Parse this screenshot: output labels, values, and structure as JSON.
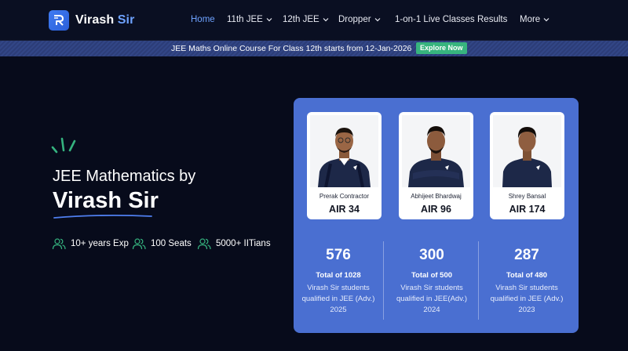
{
  "brand": {
    "name": "Virash",
    "accent": "Sir"
  },
  "nav": {
    "items": [
      {
        "label": "Home",
        "dropdown": false,
        "active": true
      },
      {
        "label": "11th JEE",
        "dropdown": true,
        "active": false
      },
      {
        "label": "12th JEE",
        "dropdown": true,
        "active": false
      },
      {
        "label": "Dropper",
        "dropdown": true,
        "active": false
      },
      {
        "label": "1-on-1 Live Classes",
        "dropdown": false,
        "active": false
      },
      {
        "label": "Results",
        "dropdown": false,
        "active": false
      },
      {
        "label": "More",
        "dropdown": true,
        "active": false
      }
    ]
  },
  "banner": {
    "text": "JEE Maths Online Course For Class 12th starts from 12-Jan-2026",
    "button": "Explore Now"
  },
  "hero": {
    "subtitle": "JEE Mathematics by",
    "title": "Virash Sir",
    "stats": [
      "10+ years Exp",
      "100 Seats",
      "5000+ IITians"
    ]
  },
  "results": {
    "students": [
      {
        "name": "Prerak Contractor",
        "air": "AIR 34"
      },
      {
        "name": "Abhijeet Bhardwaj",
        "air": "AIR 96"
      },
      {
        "name": "Shrey Bansal",
        "air": "AIR 174"
      }
    ],
    "columns": [
      {
        "count": "576",
        "total": "Total of 1028",
        "desc": "Virash Sir students qualified in JEE (Adv.) 2025"
      },
      {
        "count": "300",
        "total": "Total of 500",
        "desc": "Virash Sir students qualified in JEE(Adv.) 2024"
      },
      {
        "count": "287",
        "total": "Total of 480",
        "desc": "Virash Sir students qualified in JEE (Adv.) 2023"
      }
    ]
  },
  "colors": {
    "background": "#070b1b",
    "accent": "#6ea2ff",
    "card": "#4a6fd1",
    "button": "#37b47e",
    "icon": "#35b37f"
  }
}
